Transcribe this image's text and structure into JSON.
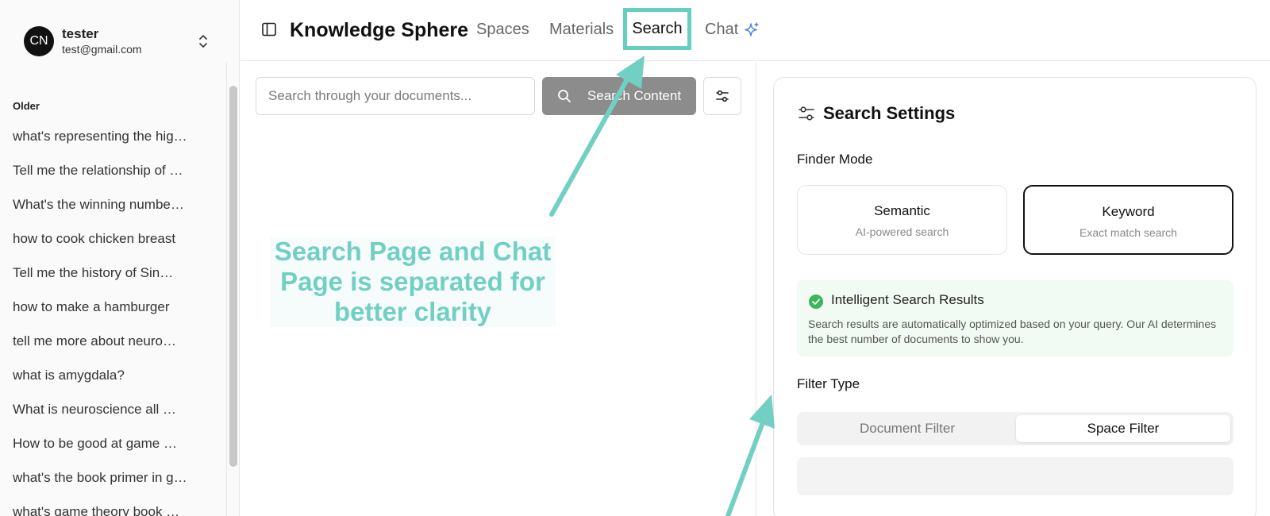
{
  "user": {
    "initials": "CN",
    "name": "tester",
    "email": "test@gmail.com"
  },
  "sidebar": {
    "section_title": "Older",
    "items": [
      "what's representing the hig…",
      "Tell me the relationship of …",
      "What's the winning numbe…",
      "how to cook chicken breast",
      "Tell me the history of Sin…",
      "how to make a hamburger",
      "tell me more about neuro…",
      "what is amygdala?",
      "What is neuroscience all …",
      "How to be good at game …",
      "what's the book primer in g…",
      "what's game theory book …"
    ]
  },
  "header": {
    "title": "Knowledge Sphere",
    "nav": {
      "spaces": "Spaces",
      "materials": "Materials",
      "search": "Search",
      "chat": "Chat"
    }
  },
  "search": {
    "placeholder": "Search through your documents...",
    "button_label": "Search Content"
  },
  "annotation": {
    "text": "Search Page and Chat Page is separated for better clarity",
    "color": "#72cfc3"
  },
  "settings": {
    "title": "Search Settings",
    "finder_mode_label": "Finder Mode",
    "modes": [
      {
        "title": "Semantic",
        "subtitle": "AI-powered search",
        "selected": false
      },
      {
        "title": "Keyword",
        "subtitle": "Exact match search",
        "selected": true
      }
    ],
    "info": {
      "title": "Intelligent Search Results",
      "text": "Search results are automatically optimized based on your query. Our AI determines the best number of documents to show you."
    },
    "filter_type_label": "Filter Type",
    "filters": [
      {
        "label": "Document Filter",
        "active": false
      },
      {
        "label": "Space Filter",
        "active": true
      }
    ]
  }
}
